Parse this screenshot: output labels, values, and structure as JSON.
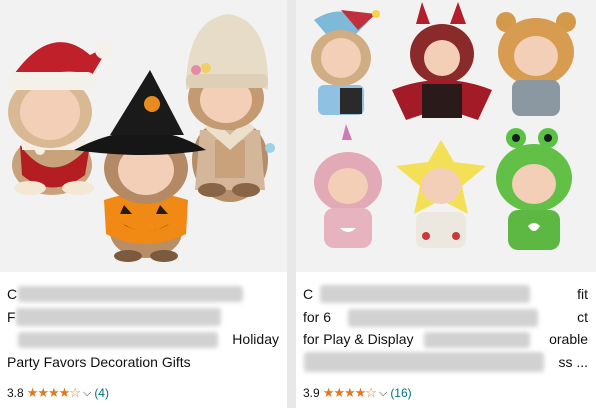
{
  "products": [
    {
      "title_lines": [
        "C",
        "F",
        "Holiday",
        "Party Favors Decoration Gifts"
      ],
      "rating": "3.8",
      "stars": "★★★★☆",
      "review_count": "(4)"
    },
    {
      "title_lines": [
        "C",
        "fit",
        "for 6",
        "ct",
        "for Play & Display",
        "orable",
        "ss ..."
      ],
      "rating": "3.9",
      "stars": "★★★★☆",
      "review_count": "(16)"
    }
  ],
  "colors": {
    "star": "#de7921",
    "link": "#007185",
    "text": "#0f1111"
  }
}
